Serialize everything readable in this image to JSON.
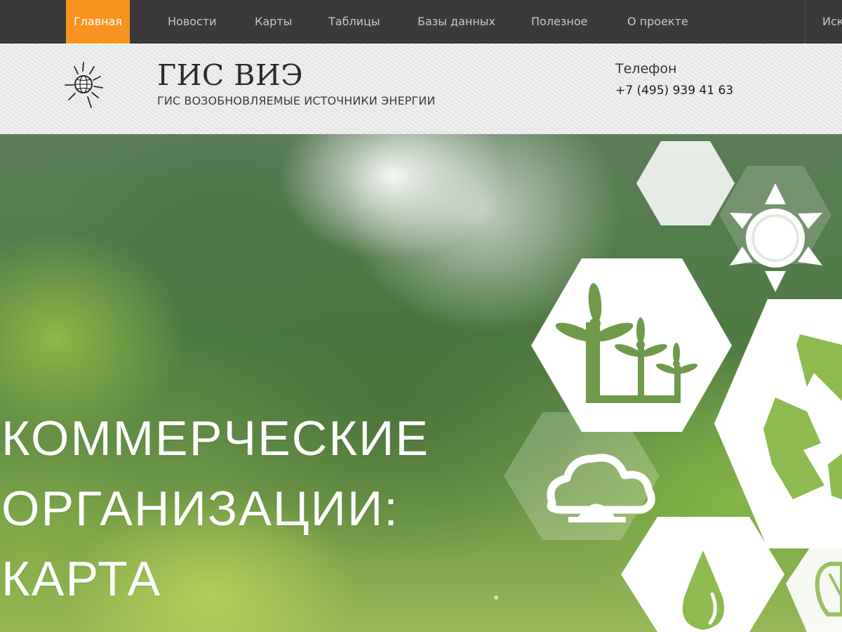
{
  "nav": {
    "items": [
      {
        "label": "Главная",
        "active": true
      },
      {
        "label": "Новости",
        "active": false
      },
      {
        "label": "Карты",
        "active": false
      },
      {
        "label": "Таблицы",
        "active": false
      },
      {
        "label": "Базы данных",
        "active": false
      },
      {
        "label": "Полезное",
        "active": false
      },
      {
        "label": "О проекте",
        "active": false
      }
    ],
    "search_label": "Искать"
  },
  "header": {
    "title": "ГИС ВИЭ",
    "subtitle": "ГИС ВОЗОБНОВЛЯЕМЫЕ ИСТОЧНИКИ ЭНЕРГИИ",
    "logo_icon": "sun-globe-icon",
    "phone_label": "Телефон",
    "phone_number": "+7 (495) 939 41 63"
  },
  "hero": {
    "title_lines": [
      "КОММЕРЧЕСКИЕ",
      "ОРГАНИЗАЦИИ:",
      "КАРТА"
    ],
    "icons": [
      "sun-icon",
      "wind-turbines-icon",
      "cloud-sun-icon",
      "water-drop-icon",
      "recycle-icon",
      "light-bulb-icon"
    ]
  },
  "colors": {
    "nav_bg": "#3a3a3a",
    "nav_active": "#f7931e",
    "nav_text": "#c9c9c9",
    "header_bg": "#ececec",
    "icon_green": "#6f9a4a"
  }
}
